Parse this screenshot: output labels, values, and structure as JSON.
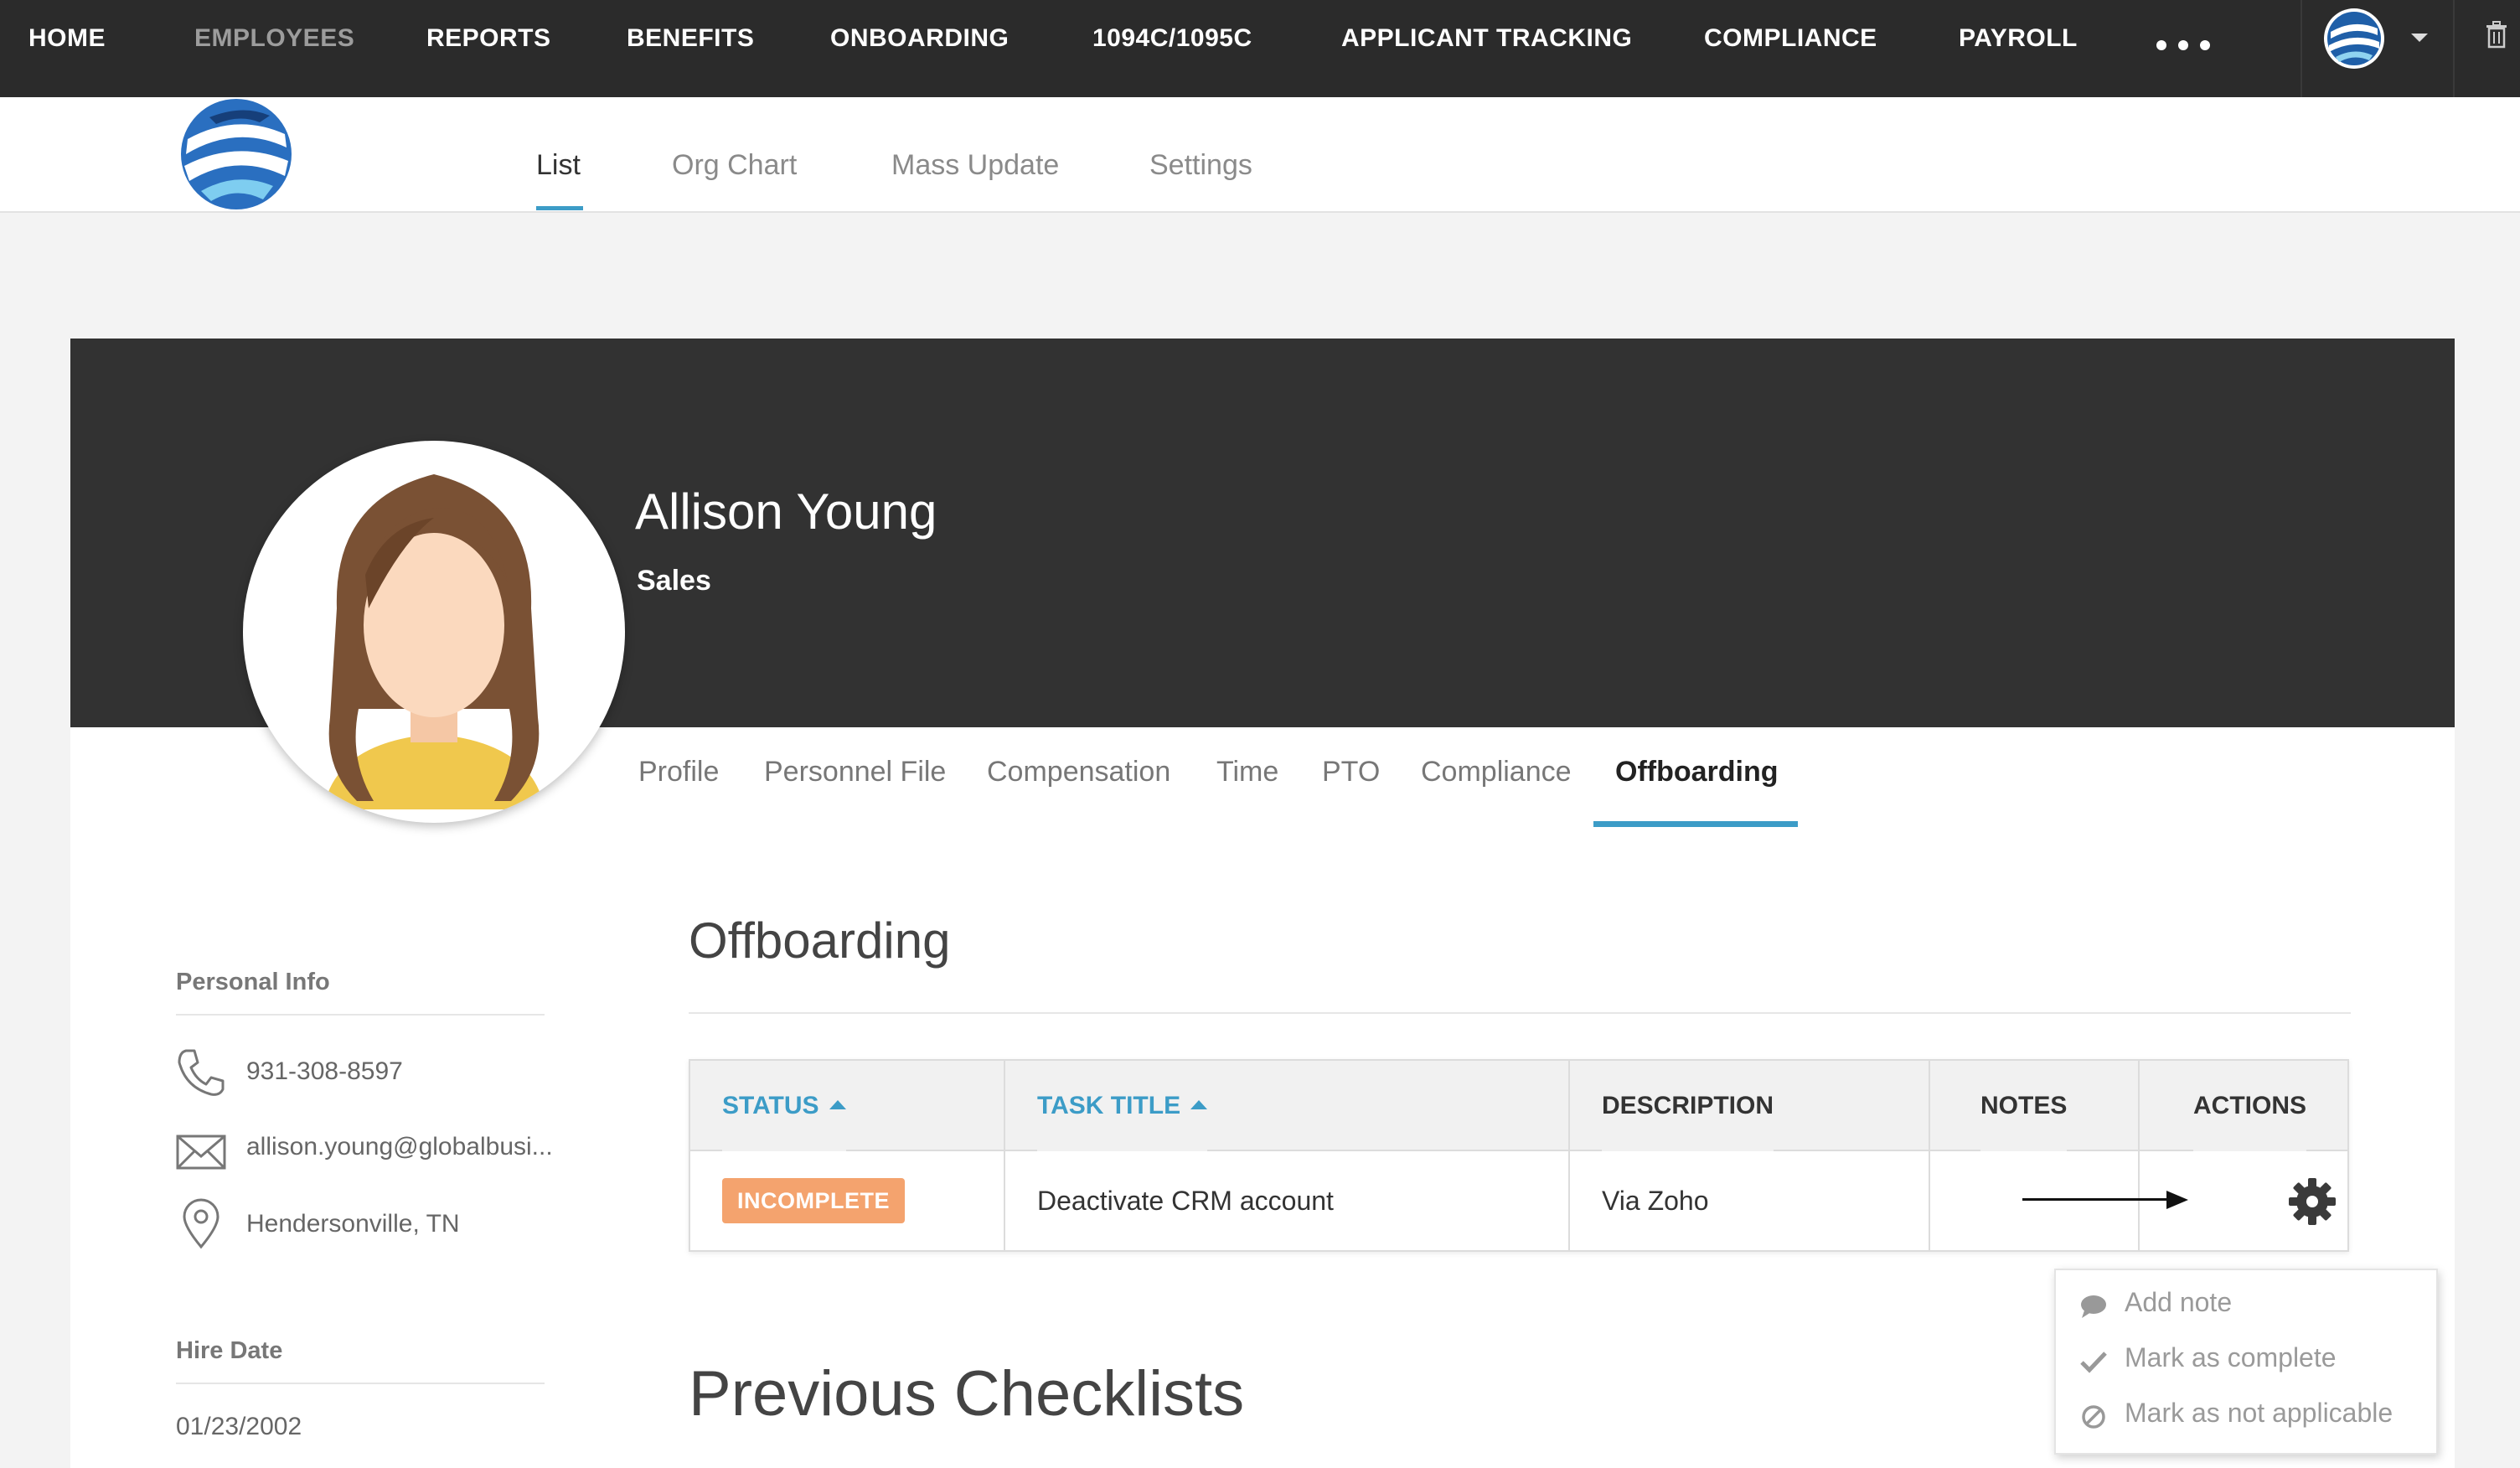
{
  "topnav": {
    "items": [
      "HOME",
      "EMPLOYEES",
      "REPORTS",
      "BENEFITS",
      "ONBOARDING",
      "1094C/1095C",
      "APPLICANT TRACKING",
      "COMPLIANCE",
      "PAYROLL"
    ],
    "more_icon": "more-dots-icon",
    "account_icon": "globe-logo-icon",
    "trash_icon": "trash-icon"
  },
  "subnav": {
    "tabs": [
      "List",
      "Org Chart",
      "Mass Update",
      "Settings"
    ],
    "active": "List"
  },
  "employee": {
    "name": "Allison Young",
    "department": "Sales"
  },
  "profile_tabs": {
    "items": [
      "Profile",
      "Personnel File",
      "Compensation",
      "Time",
      "PTO",
      "Compliance",
      "Offboarding"
    ],
    "active": "Offboarding"
  },
  "personal_info": {
    "heading": "Personal Info",
    "phone": "931-308-8597",
    "email": "allison.young@globalbusi...",
    "location": "Hendersonville, TN"
  },
  "hire_date": {
    "heading": "Hire Date",
    "value": "01/23/2002"
  },
  "offboarding": {
    "title": "Offboarding",
    "columns": {
      "status": "STATUS",
      "task_title": "TASK TITLE",
      "description": "DESCRIPTION",
      "notes": "NOTES",
      "actions": "ACTIONS"
    },
    "rows": [
      {
        "status": "INCOMPLETE",
        "task_title": "Deactivate CRM account",
        "description": "Via Zoho",
        "notes": ""
      }
    ],
    "status_color": "#f4a36e",
    "accent_color": "#3c9cc7"
  },
  "actions_menu": {
    "items": [
      {
        "label": "Add note",
        "icon": "speech-bubble-icon"
      },
      {
        "label": "Mark as complete",
        "icon": "checkmark-icon"
      },
      {
        "label": "Mark as not applicable",
        "icon": "prohibited-icon"
      }
    ]
  },
  "previous_checklists": {
    "title": "Previous Checklists"
  }
}
